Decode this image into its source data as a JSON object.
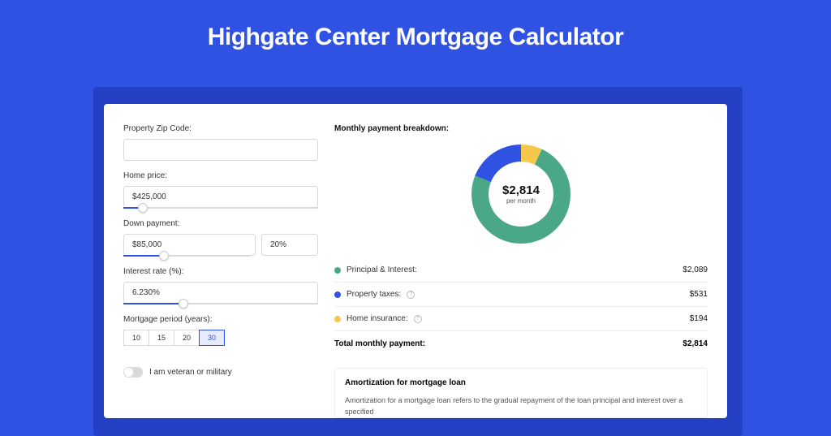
{
  "title": "Highgate Center Mortgage Calculator",
  "form": {
    "zip_label": "Property Zip Code:",
    "zip_value": "",
    "price_label": "Home price:",
    "price_value": "$425,000",
    "price_slider_pct": 10,
    "dp_label": "Down payment:",
    "dp_value": "$85,000",
    "dp_pct_value": "20%",
    "dp_slider_pct": 21,
    "rate_label": "Interest rate (%):",
    "rate_value": "6.230%",
    "rate_slider_pct": 31,
    "period_label": "Mortgage period (years):",
    "period_options": [
      "10",
      "15",
      "20",
      "30"
    ],
    "period_selected": "30",
    "veteran_label": "I am veteran or military"
  },
  "breakdown": {
    "title": "Monthly payment breakdown:",
    "center_amount": "$2,814",
    "center_sub": "per month",
    "items": [
      {
        "color": "green",
        "label": "Principal & Interest:",
        "value": "$2,089",
        "info": false
      },
      {
        "color": "blue",
        "label": "Property taxes:",
        "value": "$531",
        "info": true
      },
      {
        "color": "yellow",
        "label": "Home insurance:",
        "value": "$194",
        "info": true
      }
    ],
    "total_label": "Total monthly payment:",
    "total_value": "$2,814"
  },
  "amortization": {
    "title": "Amortization for mortgage loan",
    "text": "Amortization for a mortgage loan refers to the gradual repayment of the loan principal and interest over a specified"
  },
  "chart_data": {
    "type": "pie",
    "title": "Monthly payment breakdown",
    "series": [
      {
        "name": "Principal & Interest",
        "value": 2089,
        "color": "#4aa889"
      },
      {
        "name": "Property taxes",
        "value": 531,
        "color": "#3052e3"
      },
      {
        "name": "Home insurance",
        "value": 194,
        "color": "#f4c94b"
      }
    ],
    "total": 2814,
    "unit": "$ per month"
  }
}
